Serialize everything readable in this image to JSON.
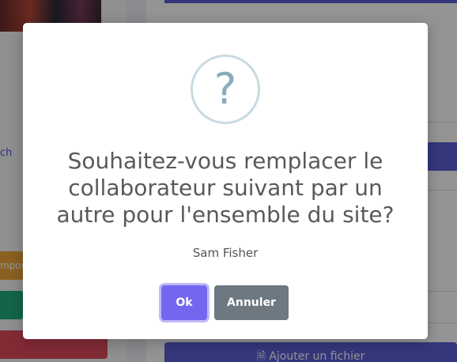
{
  "background": {
    "link_fragment": "ch",
    "import_fragment": "mport",
    "add_file_label": "Ajouter un fichier"
  },
  "modal": {
    "icon": "question-mark-icon",
    "icon_glyph": "?",
    "title": "Souhaitez-vous remplacer le collaborateur suivant par un autre pour l'ensemble du site?",
    "text": "Sam Fisher",
    "ok_label": "Ok",
    "cancel_label": "Annuler"
  },
  "colors": {
    "ok_button": "#7367f0",
    "cancel_button": "#6e7881",
    "icon_ring": "#c9dae1",
    "icon_glyph": "#87adbd",
    "accent_bg": "#5b5fd6"
  }
}
